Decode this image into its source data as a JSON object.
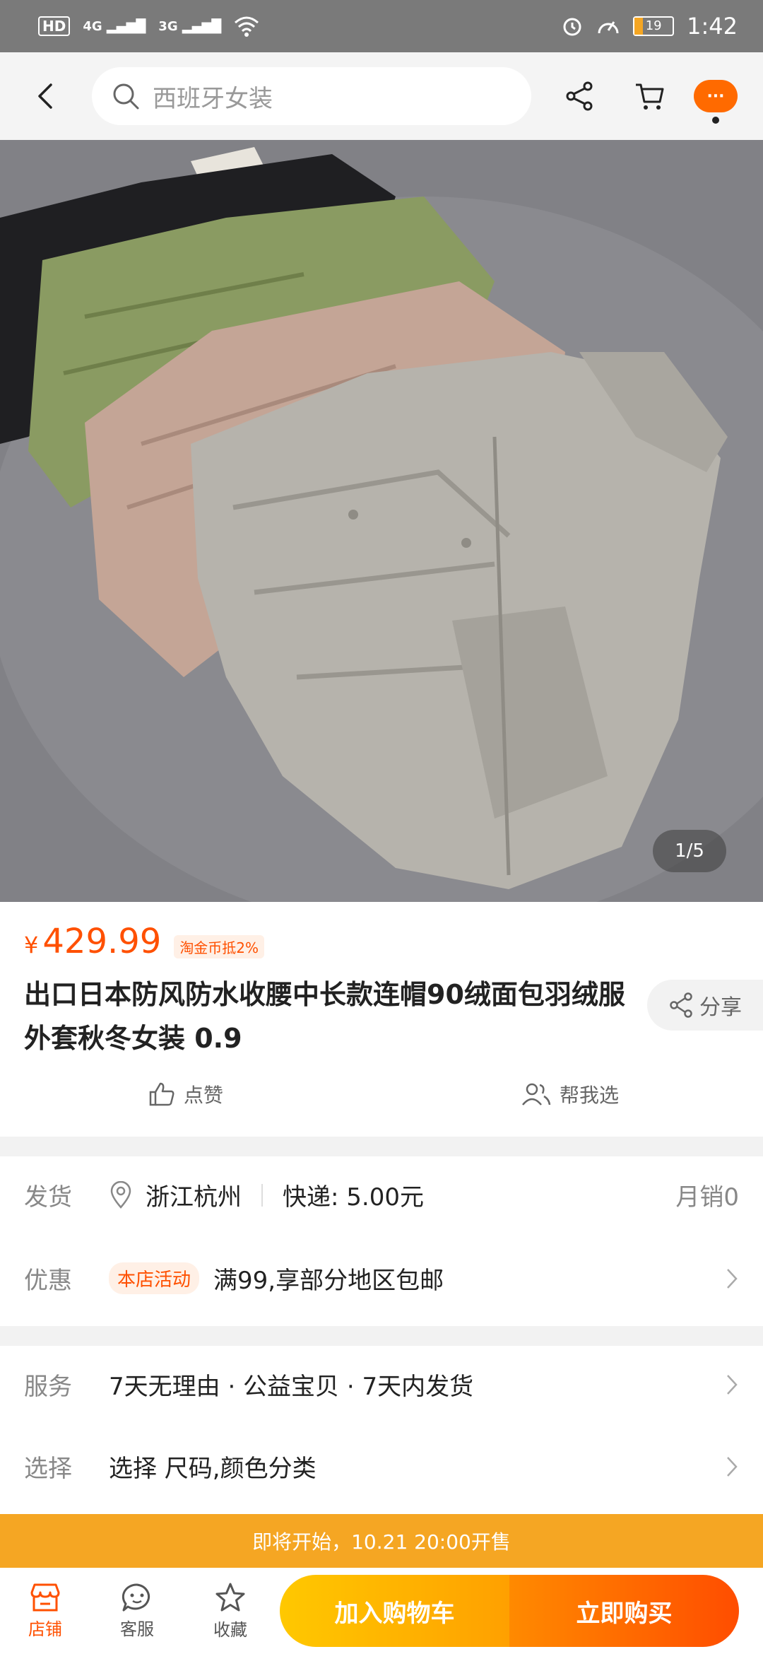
{
  "status_bar": {
    "hd": "HD",
    "sim1": "4G",
    "sim2": "3G",
    "battery": "19",
    "time": "1:42"
  },
  "nav": {
    "search_text": "西班牙女装"
  },
  "gallery": {
    "counter": "1/5"
  },
  "product": {
    "currency": "¥",
    "price": "429.99",
    "coin_tag": "淘金币抵2%",
    "title": "出口日本防风防水收腰中长款连帽90绒面包羽绒服外套秋冬女装 0.9",
    "share_label": "分享",
    "like_label": "点赞",
    "help_label": "帮我选"
  },
  "delivery": {
    "ship_label": "发货",
    "location": "浙江杭州",
    "express": "快递: 5.00元",
    "monthly_sales": "月销0",
    "promo_label": "优惠",
    "promo_tag": "本店活动",
    "promo_text": "满99,享部分地区包邮"
  },
  "services": {
    "service_label": "服务",
    "service_text": "7天无理由 · 公益宝贝 · 7天内发货",
    "select_label": "选择",
    "select_text": "选择 尺码,颜色分类"
  },
  "presale": {
    "text": "即将开始，10.21 20:00开售"
  },
  "bottom_bar": {
    "store": "店铺",
    "service": "客服",
    "favorite": "收藏",
    "add_to_cart": "加入购物车",
    "buy_now": "立即购买"
  },
  "colors": {
    "accent": "#ff5000",
    "presale_bg": "#f5a623"
  }
}
